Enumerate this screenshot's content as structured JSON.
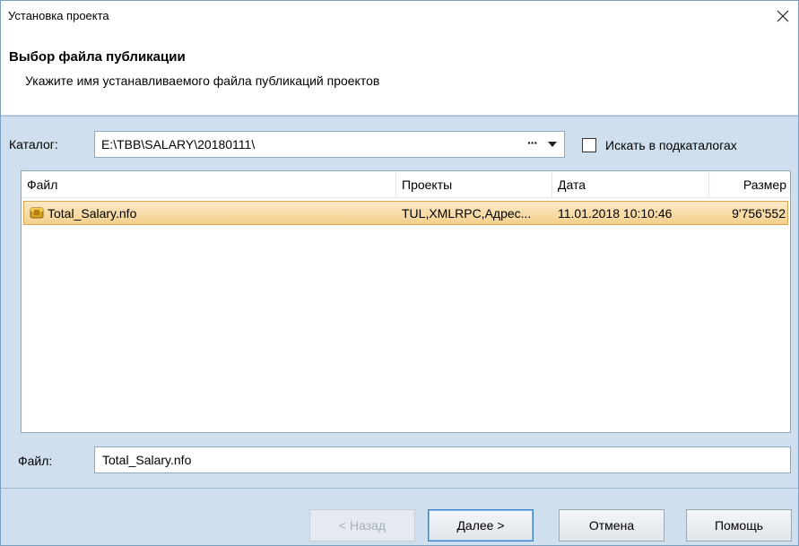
{
  "window": {
    "title": "Установка проекта"
  },
  "header": {
    "title": "Выбор файла публикации",
    "subtitle": "Укажите имя устанавливаемого файла публикаций проектов"
  },
  "catalog": {
    "label": "Каталог:",
    "value": "E:\\TBB\\SALARY\\20180111\\",
    "browse": "···",
    "search_subdirs_label": "Искать в подкаталогах",
    "search_subdirs_checked": false
  },
  "list": {
    "columns": [
      "Файл",
      "Проекты",
      "Дата",
      "Размер"
    ],
    "rows": [
      {
        "file": "Total_Salary.nfo",
        "projects": "TUL,XMLRPC,Адрес...",
        "date": "11.01.2018 10:10:46",
        "size": "9'756'552",
        "selected": true
      }
    ]
  },
  "file_field": {
    "label": "Файл:",
    "value": "Total_Salary.nfo"
  },
  "buttons": {
    "back": "< Назад",
    "next": "Далее >",
    "cancel": "Отмена",
    "help": "Помощь"
  },
  "colors": {
    "panel": "#cfdfee",
    "selection": "#f4cf8c",
    "accent_border": "#3c7fc6"
  }
}
